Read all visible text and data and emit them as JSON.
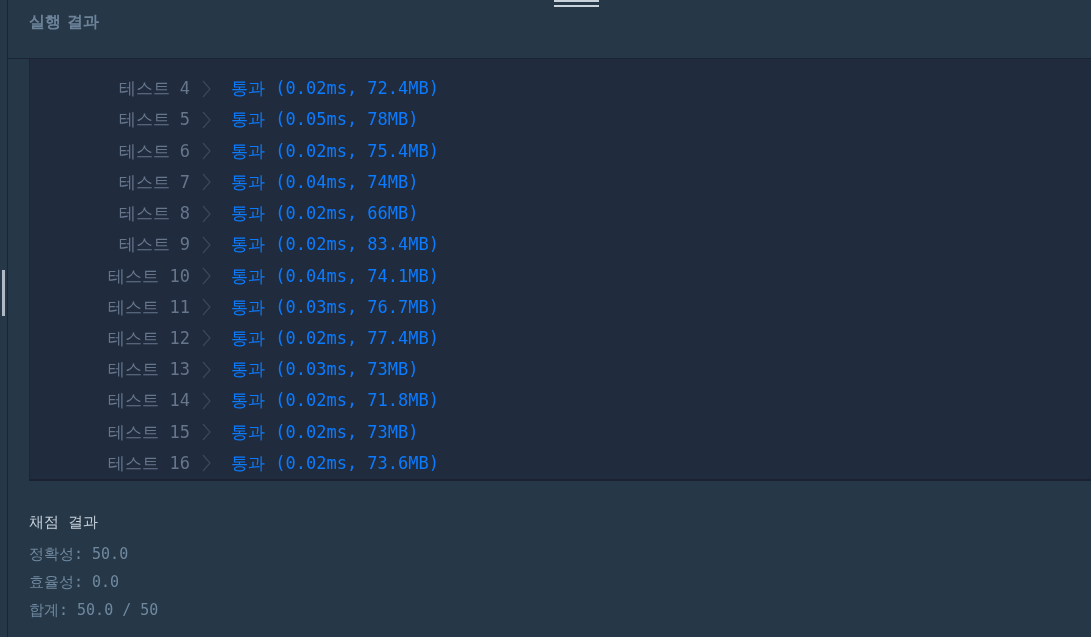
{
  "panel": {
    "title": "실행 결과"
  },
  "results": [
    {
      "label": "테스트 4",
      "passed": true,
      "result": "통과 (0.02ms, 72.4MB)"
    },
    {
      "label": "테스트 5",
      "passed": true,
      "result": "통과 (0.05ms, 78MB)"
    },
    {
      "label": "테스트 6",
      "passed": true,
      "result": "통과 (0.02ms, 75.4MB)"
    },
    {
      "label": "테스트 7",
      "passed": true,
      "result": "통과 (0.04ms, 74MB)"
    },
    {
      "label": "테스트 8",
      "passed": true,
      "result": "통과 (0.02ms, 66MB)"
    },
    {
      "label": "테스트 9",
      "passed": true,
      "result": "통과 (0.02ms, 83.4MB)"
    },
    {
      "label": "테스트 10",
      "passed": true,
      "result": "통과 (0.04ms, 74.1MB)"
    },
    {
      "label": "테스트 11",
      "passed": true,
      "result": "통과 (0.03ms, 76.7MB)"
    },
    {
      "label": "테스트 12",
      "passed": true,
      "result": "통과 (0.02ms, 77.4MB)"
    },
    {
      "label": "테스트 13",
      "passed": true,
      "result": "통과 (0.03ms, 73MB)"
    },
    {
      "label": "테스트 14",
      "passed": true,
      "result": "통과 (0.02ms, 71.8MB)"
    },
    {
      "label": "테스트 15",
      "passed": true,
      "result": "통과 (0.02ms, 73MB)"
    },
    {
      "label": "테스트 16",
      "passed": true,
      "result": "통과 (0.02ms, 73.6MB)"
    }
  ],
  "grading": {
    "title": "채점 결과",
    "lines": [
      "정확성: 50.0",
      "효율성: 0.0",
      "합계: 50.0 / 50"
    ]
  }
}
